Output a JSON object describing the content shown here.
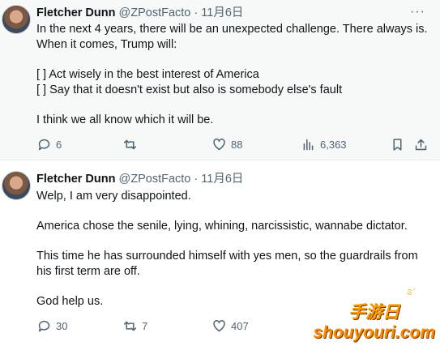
{
  "tweets": [
    {
      "author_name": "Fletcher Dunn",
      "author_handle": "@ZPostFacto",
      "separator": "·",
      "date": "11月6日",
      "more_label": "···",
      "lines": [
        "In the next 4 years, there will be an unexpected challenge.  There always is.",
        " When it comes, Trump will:",
        "[  ] Act wisely in the best interest of America",
        "[  ] Say that it doesn't exist but also is somebody else's fault",
        "I think we all know which it will be."
      ],
      "replies": "6",
      "retweets": "",
      "likes": "88",
      "views": "6,363"
    },
    {
      "author_name": "Fletcher Dunn",
      "author_handle": "@ZPostFacto",
      "separator": "·",
      "date": "11月6日",
      "lines": [
        "Welp, I am very disappointed.",
        "America chose the senile, lying, whining, narcissistic, wannabe dictator.",
        "This time he has surrounded himself with yes men, so the guardrails from",
        "his first term are off.",
        "God help us."
      ],
      "replies": "30",
      "retweets": "7",
      "likes": "407"
    }
  ],
  "watermark": {
    "cn": "手游日",
    "en": "shouyouri.com",
    "deco": "ミ゛"
  },
  "icons": [
    "reply-icon",
    "retweet-icon",
    "like-icon",
    "views-icon",
    "bookmark-icon",
    "share-icon",
    "more-icon"
  ]
}
